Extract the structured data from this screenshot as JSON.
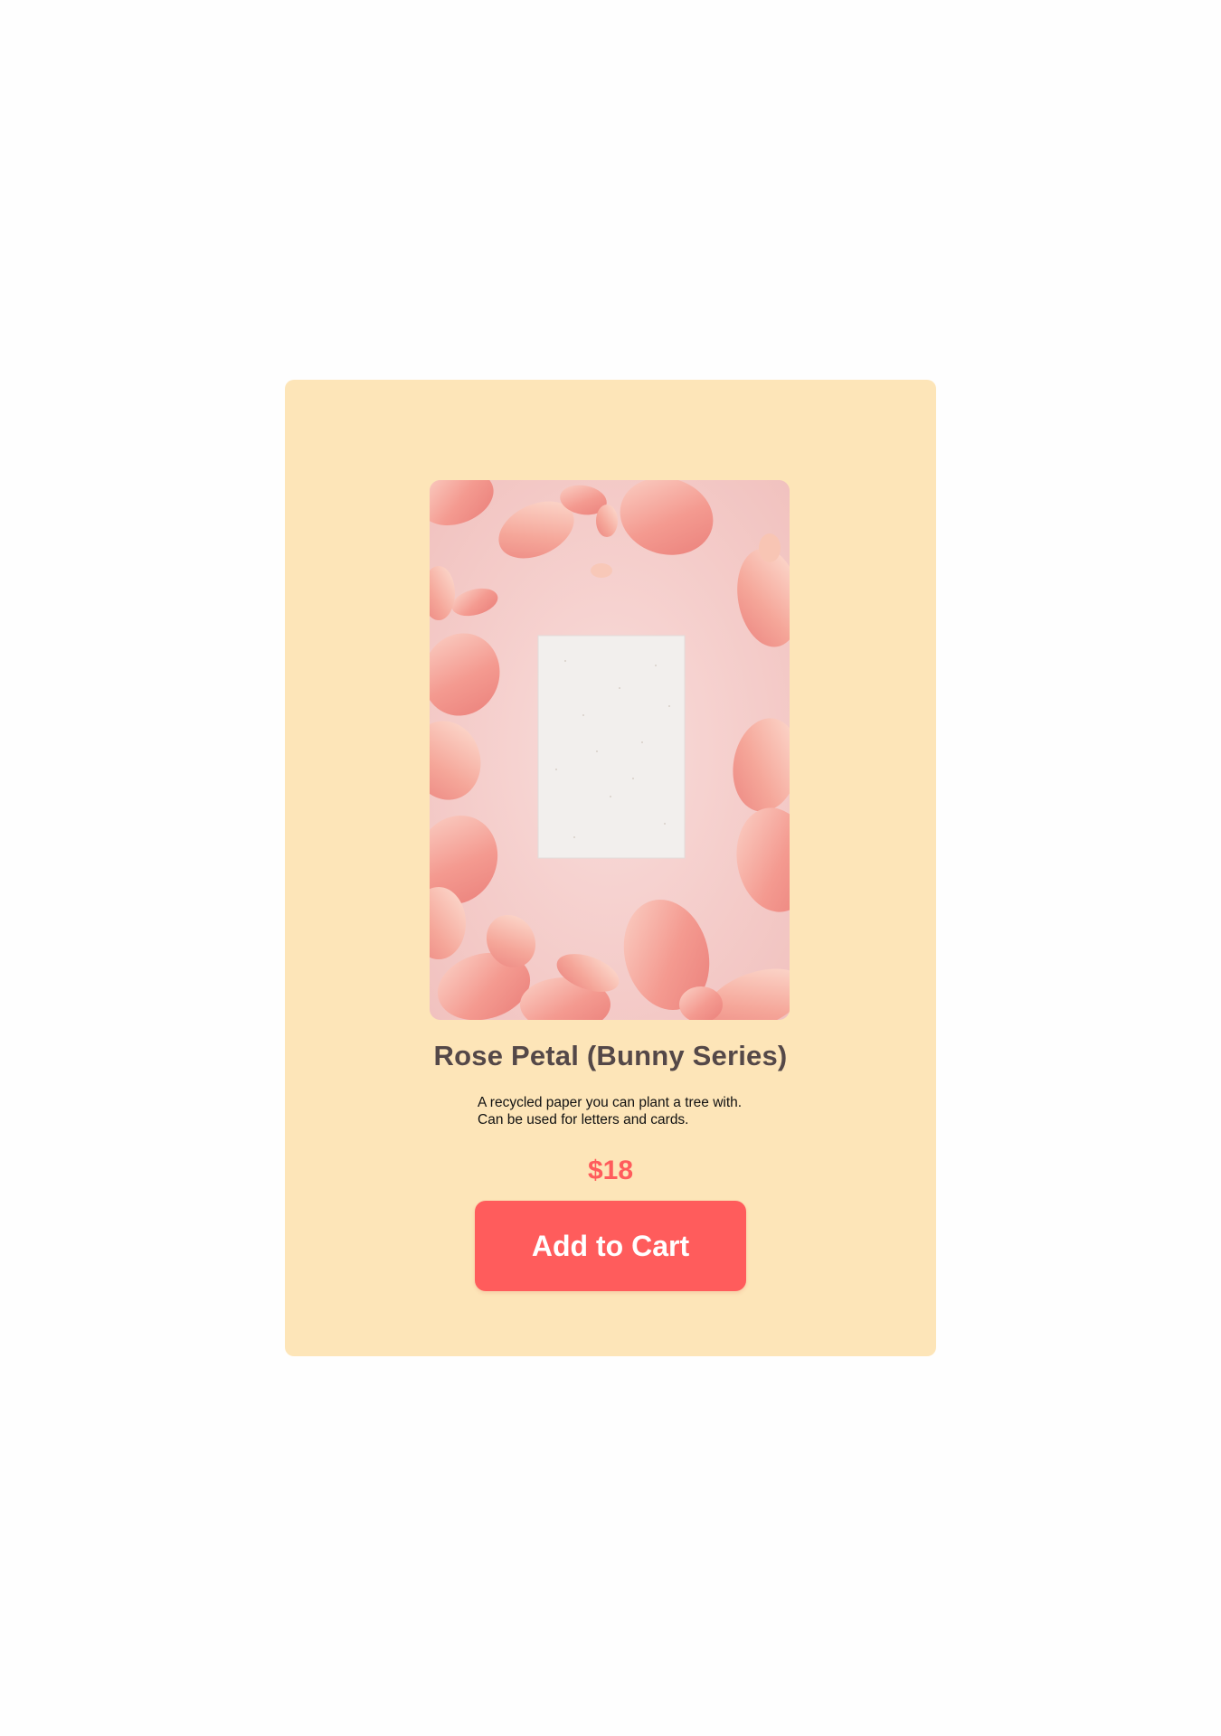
{
  "product": {
    "image_alt": "Rose petals arranged around a blank sheet of recycled paper",
    "title": "Rose Petal (Bunny Series)",
    "description": "A recycled paper you can plant a tree with. Can be used for letters and cards.",
    "price": "$18",
    "add_to_cart_label": "Add to Cart"
  },
  "colors": {
    "page_background": "#fefefe",
    "card_background": "#fde5b8",
    "accent": "#ff5c5c",
    "title_text": "#544848",
    "body_text": "#111111",
    "photo_background": "#f3c8c6",
    "petal": "#f29a92"
  }
}
